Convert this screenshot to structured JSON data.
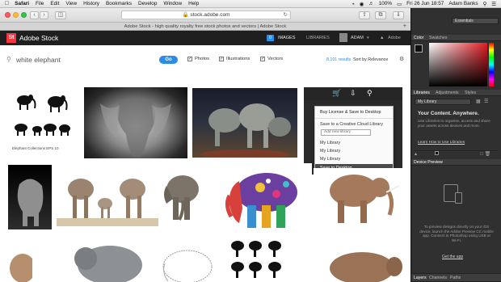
{
  "menubar": {
    "app_name": "Safari",
    "items": [
      "File",
      "Edit",
      "View",
      "History",
      "Bookmarks",
      "Develop",
      "Window",
      "Help"
    ],
    "percent": "100%",
    "datetime": "Fri 26 Jun 18:57",
    "user": "Adam Banks"
  },
  "browser": {
    "url": "stock.adobe.com",
    "tab_title": "Adobe Stock - high quality royalty free stock photos and vectors | Adobe Stock"
  },
  "stock": {
    "logo": "St",
    "brand": "Adobe Stock",
    "nav_count": "0",
    "nav_images": "IMAGES",
    "nav_libraries": "LIBRARIES",
    "user": "ADAM",
    "adobe": "Adobe"
  },
  "search": {
    "query": "white elephant",
    "go_label": "Go",
    "filters": [
      {
        "label": "Photos",
        "checked": true
      },
      {
        "label": "Illustrations",
        "checked": true
      },
      {
        "label": "Vectors",
        "checked": true
      }
    ],
    "results": "8,101 results",
    "sort_label": "Sort by Relevance"
  },
  "first_image_caption": "Elephant Collections EPS 10",
  "license_menu": {
    "title": "Buy License & Save to Desktop",
    "save_to_cc": "Save to a Creative Cloud Library",
    "new_library_placeholder": "Add new library",
    "libraries": [
      "My Library",
      "My Library",
      "My Library"
    ],
    "save_desktop": "Save to Desktop"
  },
  "photoshop": {
    "workspace": "Essentials",
    "color_tabs": [
      "Color",
      "Swatches"
    ],
    "library_tabs": [
      "Libraries",
      "Adjustments",
      "Styles"
    ],
    "library_select": "My Library",
    "promo_title": "Your Content. Anywhere.",
    "promo_text": "Use Libraries to organise, access and share your assets across devices and more.",
    "promo_link": "Learn How to Use Libraries",
    "device_preview_title": "Device Preview",
    "device_text": "To preview designs directly on your iOS device, launch the Adobe Preview CC mobile app. Connect to Photoshop using USB or Wi-Fi.",
    "device_link": "Get the app",
    "bottom_tabs": [
      "Layers",
      "Channels",
      "Paths"
    ]
  },
  "colors": {
    "adobe_red": "#f7343f",
    "go_blue": "#2c8ce6",
    "ps_panel": "#303030"
  }
}
